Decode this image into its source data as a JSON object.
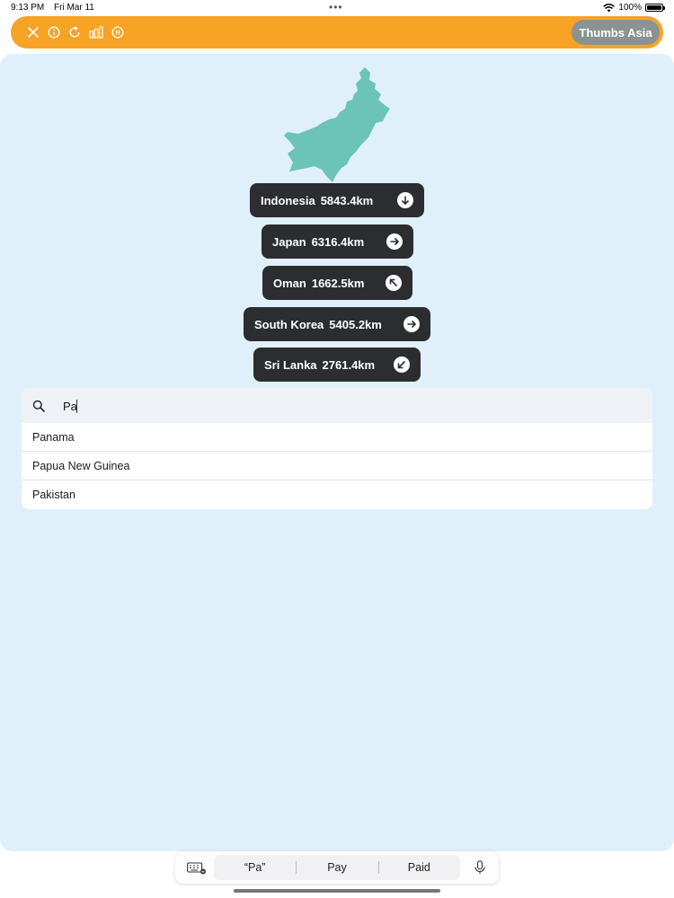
{
  "status_bar": {
    "time": "9:13 PM",
    "date": "Fri Mar 11",
    "battery": "100%"
  },
  "toolbar": {
    "icons": [
      "close-icon",
      "info-icon",
      "refresh-icon",
      "stats-icon",
      "pause-icon"
    ],
    "game_label": "Thumbs Asia",
    "accent_color": "#f7a325"
  },
  "silhouette": {
    "color": "#6cc3b8"
  },
  "guesses": [
    {
      "country": "Indonesia",
      "distance": "5843.4km",
      "direction": "down"
    },
    {
      "country": "Japan",
      "distance": "6316.4km",
      "direction": "right"
    },
    {
      "country": "Oman",
      "distance": "1662.5km",
      "direction": "up-left"
    },
    {
      "country": "South Korea",
      "distance": "5405.2km",
      "direction": "right"
    },
    {
      "country": "Sri Lanka",
      "distance": "2761.4km",
      "direction": "down-left"
    }
  ],
  "search": {
    "value": "Pa",
    "placeholder": ""
  },
  "suggestions": [
    "Panama",
    "Papua New Guinea",
    "Pakistan"
  ],
  "keyboard_bar": {
    "predictions": [
      "“Pa”",
      "Pay",
      "Paid"
    ]
  }
}
